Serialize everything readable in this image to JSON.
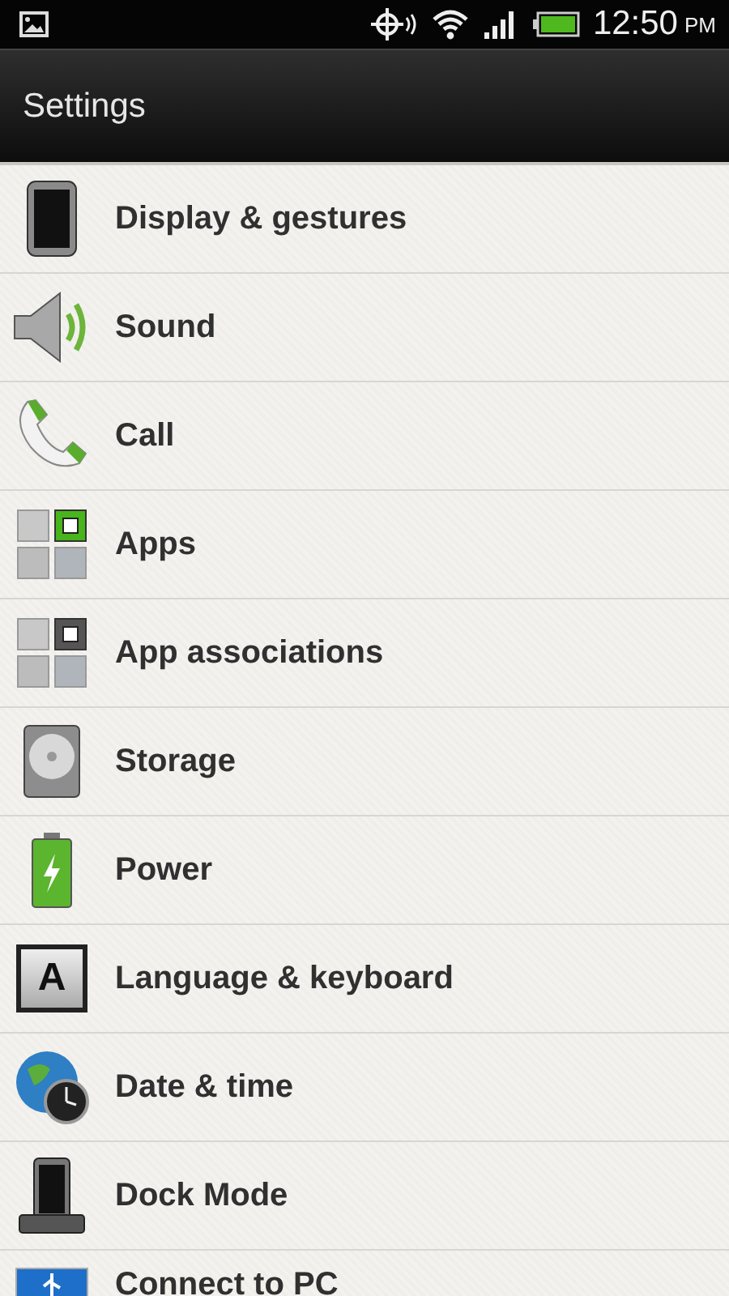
{
  "status_bar": {
    "time": "12:50",
    "period": "PM"
  },
  "header": {
    "title": "Settings"
  },
  "items": [
    {
      "kind": "display",
      "label": "Display & gestures"
    },
    {
      "kind": "sound",
      "label": "Sound"
    },
    {
      "kind": "call",
      "label": "Call"
    },
    {
      "kind": "apps",
      "label": "Apps"
    },
    {
      "kind": "associations",
      "label": "App associations"
    },
    {
      "kind": "storage",
      "label": "Storage"
    },
    {
      "kind": "power",
      "label": "Power"
    },
    {
      "kind": "language",
      "label": "Language & keyboard",
      "icon_letter": "A"
    },
    {
      "kind": "datetime",
      "label": "Date & time"
    },
    {
      "kind": "dock",
      "label": "Dock Mode"
    },
    {
      "kind": "usb",
      "label": "Connect to PC"
    }
  ]
}
